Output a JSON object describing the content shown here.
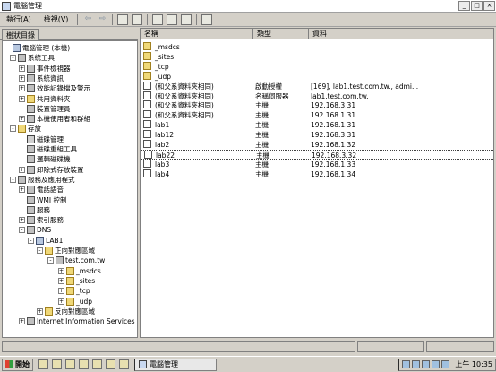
{
  "window": {
    "title": "電腦管理",
    "min": "_",
    "max": "□",
    "close": "×"
  },
  "menu": {
    "action": "執行(A)",
    "view": "檢視(V)"
  },
  "toolbar": {
    "back": "⇦",
    "forward": "⇨"
  },
  "tree_tab": "樹狀目錄",
  "tree": [
    {
      "label": "電腦管理 (本機)",
      "icon": "computer-icon",
      "exp": ""
    },
    {
      "label": "系統工具",
      "icon": "tools-icon",
      "exp": "-"
    },
    {
      "label": "事件檢視器",
      "icon": "event-viewer-icon",
      "exp": "+"
    },
    {
      "label": "系統資訊",
      "icon": "info-icon",
      "exp": "+"
    },
    {
      "label": "效能記錄檔及警示",
      "icon": "performance-icon",
      "exp": "+"
    },
    {
      "label": "共用資料夾",
      "icon": "shared-folder-icon",
      "exp": "+"
    },
    {
      "label": "裝置管理員",
      "icon": "device-manager-icon",
      "exp": ""
    },
    {
      "label": "本機使用者和群組",
      "icon": "users-icon",
      "exp": "+"
    },
    {
      "label": "存放",
      "icon": "storage-icon",
      "exp": "-"
    },
    {
      "label": "磁碟管理",
      "icon": "disk-icon",
      "exp": ""
    },
    {
      "label": "磁碟重組工具",
      "icon": "defrag-icon",
      "exp": ""
    },
    {
      "label": "邏輯磁碟機",
      "icon": "logical-drive-icon",
      "exp": ""
    },
    {
      "label": "卸除式存放裝置",
      "icon": "removable-storage-icon",
      "exp": "+"
    },
    {
      "label": "服務及應用程式",
      "icon": "services-apps-icon",
      "exp": "-"
    },
    {
      "label": "電話語音",
      "icon": "telephony-icon",
      "exp": "+"
    },
    {
      "label": "WMI 控制",
      "icon": "wmi-icon",
      "exp": ""
    },
    {
      "label": "服務",
      "icon": "services-icon",
      "exp": ""
    },
    {
      "label": "索引服務",
      "icon": "index-icon",
      "exp": "+"
    },
    {
      "label": "DNS",
      "icon": "dns-icon",
      "exp": "-"
    },
    {
      "label": "LAB1",
      "icon": "server-icon",
      "exp": "-"
    },
    {
      "label": "正向對應區域",
      "icon": "folder-icon",
      "exp": "-"
    },
    {
      "label": "test.com.tw",
      "icon": "zone-icon",
      "exp": "-"
    },
    {
      "label": "_msdcs",
      "icon": "folder-icon",
      "exp": "+"
    },
    {
      "label": "_sites",
      "icon": "folder-icon",
      "exp": "+"
    },
    {
      "label": "_tcp",
      "icon": "folder-icon",
      "exp": "+"
    },
    {
      "label": "_udp",
      "icon": "folder-icon",
      "exp": "+"
    },
    {
      "label": "反向對應區域",
      "icon": "folder-icon",
      "exp": "+"
    },
    {
      "label": "Internet Information Services",
      "icon": "iis-icon",
      "exp": "+"
    }
  ],
  "columns": {
    "name": "名稱",
    "type": "類型",
    "data": "資料"
  },
  "rows": [
    {
      "name": "_msdcs",
      "type": "",
      "data": "",
      "icon": "folder"
    },
    {
      "name": "_sites",
      "type": "",
      "data": "",
      "icon": "folder"
    },
    {
      "name": "_tcp",
      "type": "",
      "data": "",
      "icon": "folder"
    },
    {
      "name": "_udp",
      "type": "",
      "data": "",
      "icon": "folder"
    },
    {
      "name": "(和父系資料夾相同)",
      "type": "啟動授權",
      "data": "[169], lab1.test.com.tw., admi...",
      "icon": "record"
    },
    {
      "name": "(和父系資料夾相同)",
      "type": "名稱伺服器",
      "data": "lab1.test.com.tw.",
      "icon": "record"
    },
    {
      "name": "(和父系資料夾相同)",
      "type": "主機",
      "data": "192.168.3.31",
      "icon": "record"
    },
    {
      "name": "(和父系資料夾相同)",
      "type": "主機",
      "data": "192.168.1.31",
      "icon": "record"
    },
    {
      "name": "lab1",
      "type": "主機",
      "data": "192.168.1.31",
      "icon": "record"
    },
    {
      "name": "lab12",
      "type": "主機",
      "data": "192.168.3.31",
      "icon": "record"
    },
    {
      "name": "lab2",
      "type": "主機",
      "data": "192.168.1.32",
      "icon": "record"
    },
    {
      "name": "lab22",
      "type": "主機",
      "data": "192.168.3.32",
      "icon": "record"
    },
    {
      "name": "lab3",
      "type": "主機",
      "data": "192.168.1.33",
      "icon": "record"
    },
    {
      "name": "lab4",
      "type": "主機",
      "data": "192.168.1.34",
      "icon": "record"
    }
  ],
  "taskbar": {
    "start": "開始",
    "task": "電腦管理",
    "clock": "上午 10:35"
  }
}
